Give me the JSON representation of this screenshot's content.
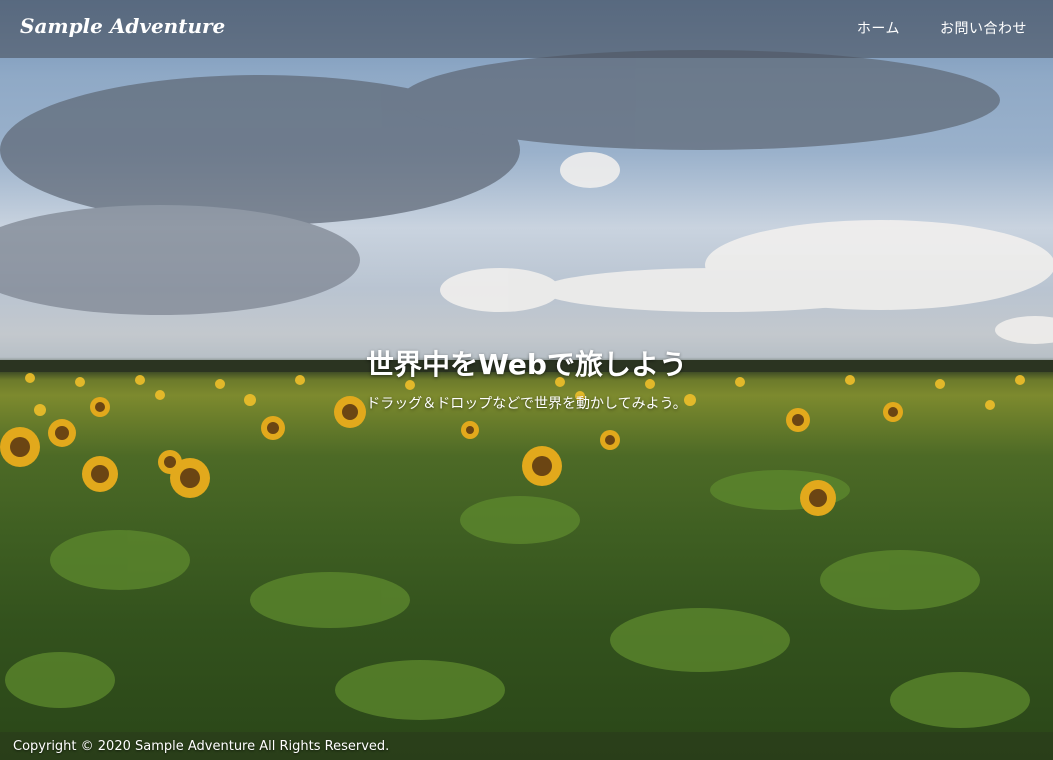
{
  "site": {
    "brand": "Sample Adventure"
  },
  "nav": {
    "items": [
      {
        "label": "ホーム"
      },
      {
        "label": "お問い合わせ"
      }
    ]
  },
  "hero": {
    "headline": "世界中をWebで旅しよう",
    "subhead": "ドラッグ＆ドロップなどで世界を動かしてみよう。",
    "image": "sunflower-field-under-cloudy-sky"
  },
  "footer": {
    "copyright": "Copyright © 2020 Sample Adventure All Rights Reserved."
  },
  "colors": {
    "navbar": "#4a5260",
    "sky": "#8fa9c6",
    "foliage": "#3f5f22",
    "sunflower": "#e2a91c",
    "text": "#ffffff"
  }
}
